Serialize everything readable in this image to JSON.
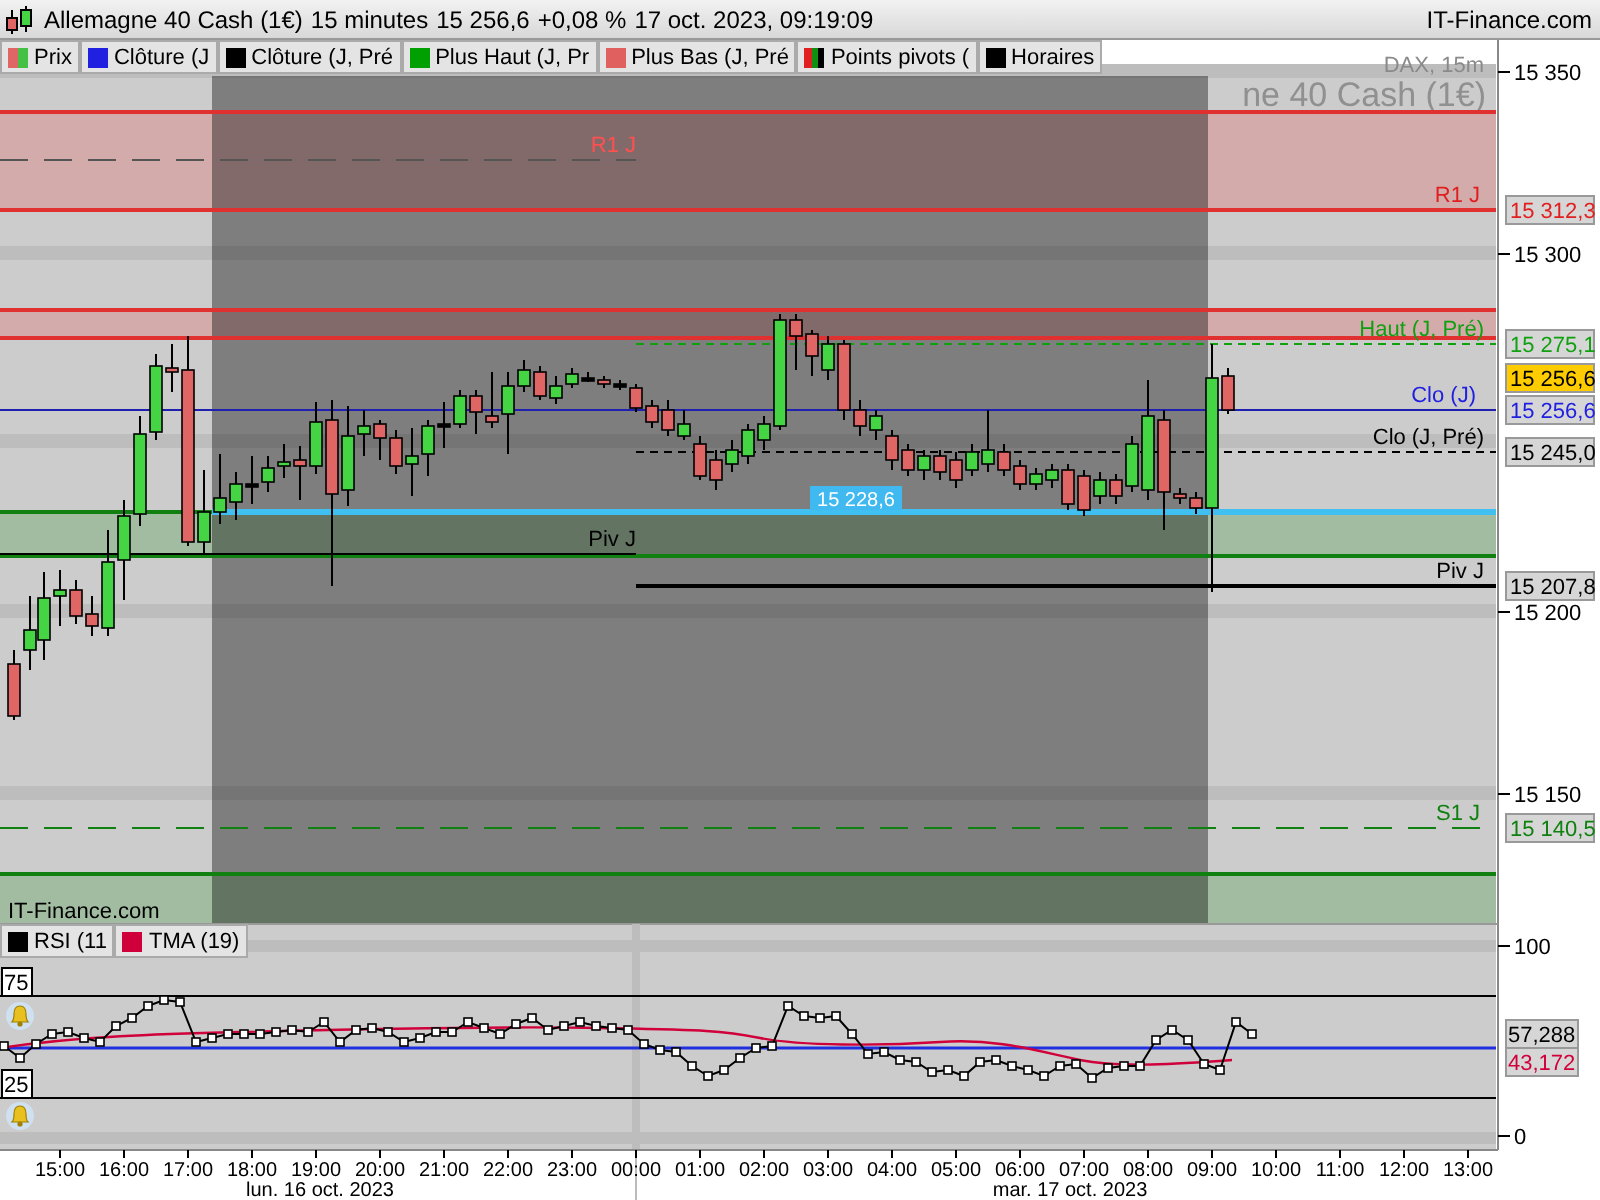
{
  "window": {
    "title": "Allemagne 40 Cash (1€)",
    "interval": "15 minutes",
    "price": "15 256,6",
    "change": "+0,08 %",
    "timestamp": "17 oct. 2023, 09:19:09",
    "brand": "IT-Finance.com"
  },
  "legend": [
    {
      "label": "Prix",
      "kind": "candles"
    },
    {
      "label": "Clôture (J",
      "kind": "solid",
      "color": "#2020e0"
    },
    {
      "label": "Clôture (J, Pré",
      "kind": "solid",
      "color": "#000000"
    },
    {
      "label": "Plus Haut (J, Pr",
      "kind": "solid",
      "color": "#00a000"
    },
    {
      "label": "Plus Bas (J, Pré",
      "kind": "solid",
      "color": "#e06060"
    },
    {
      "label": "Points pivots (",
      "kind": "pivots"
    },
    {
      "label": "Horaires",
      "kind": "solid",
      "color": "#000000"
    }
  ],
  "price_chart": {
    "watermark_symbol": "DAX, 15m",
    "watermark_name": "ne 40 Cash (1€)",
    "source": "IT-Finance.com",
    "y_ticks": [
      "15 350",
      "15 300",
      "15 200",
      "15 150"
    ],
    "last_price": "15 256,6",
    "lines": [
      {
        "kind": "resistance_prev",
        "label": "R1 J"
      },
      {
        "kind": "resistance",
        "label": "R1 J",
        "tag": "15 312,3"
      },
      {
        "kind": "high_prev",
        "label": "Haut (J, Pré)",
        "tag": "15 275,1"
      },
      {
        "kind": "close",
        "label": "Clo (J)",
        "tag": "15 256,6"
      },
      {
        "kind": "close_prev",
        "label": "Clo (J, Pré)",
        "tag": "15 245,0"
      },
      {
        "kind": "session_open",
        "label": "15 228,6"
      },
      {
        "kind": "pivot_prev",
        "label": "Piv J"
      },
      {
        "kind": "pivot",
        "label": "Piv J",
        "tag": "15 207,8"
      },
      {
        "kind": "support",
        "label": "S1 J",
        "tag": "15 140,5"
      }
    ]
  },
  "rsi_panel": {
    "legend": [
      {
        "label": "RSI (11",
        "color": "#000000"
      },
      {
        "label": "TMA (19)",
        "color": "#d0003a"
      }
    ],
    "levels": [
      "75",
      "25"
    ],
    "y_ticks": [
      "100",
      "0"
    ],
    "tags": [
      {
        "label": "57,288",
        "kind": "rsi"
      },
      {
        "label": "43,172",
        "kind": "tma"
      }
    ]
  },
  "time_axis": {
    "hours": [
      "15:00",
      "16:00",
      "17:00",
      "18:00",
      "19:00",
      "20:00",
      "21:00",
      "22:00",
      "23:00",
      "00:00",
      "01:00",
      "02:00",
      "03:00",
      "04:00",
      "05:00",
      "06:00",
      "07:00",
      "08:00",
      "09:00",
      "10:00",
      "11:00",
      "12:00",
      "13:00"
    ],
    "dates": [
      "lun. 16 oct. 2023",
      "mar. 17 oct. 2023"
    ]
  }
}
